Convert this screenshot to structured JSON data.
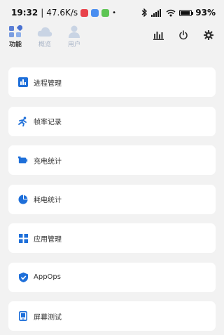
{
  "status_bar": {
    "time": "19:32",
    "separator": "|",
    "net_speed": "47.6K/s",
    "battery_percent": "93%",
    "battery_level": 0.93
  },
  "tabs": [
    {
      "label": "功能",
      "icon": "grid-icon",
      "active": true
    },
    {
      "label": "概览",
      "icon": "cloud-icon",
      "active": false
    },
    {
      "label": "用户",
      "icon": "user-icon",
      "active": false
    }
  ],
  "menu_items": [
    {
      "label": "进程管理",
      "icon": "bar-chart-icon"
    },
    {
      "label": "帧率记录",
      "icon": "running-icon"
    },
    {
      "label": "充电统计",
      "icon": "battery-charge-icon"
    },
    {
      "label": "耗电统计",
      "icon": "pie-chart-icon"
    },
    {
      "label": "应用管理",
      "icon": "apps-grid-icon"
    },
    {
      "label": "AppOps",
      "icon": "shield-check-icon"
    },
    {
      "label": "屏幕测试",
      "icon": "screen-icon"
    }
  ],
  "colors": {
    "accent": "#1e6fd9",
    "inactive_tab": "#a7b3c6",
    "background": "#f2f2f2"
  }
}
